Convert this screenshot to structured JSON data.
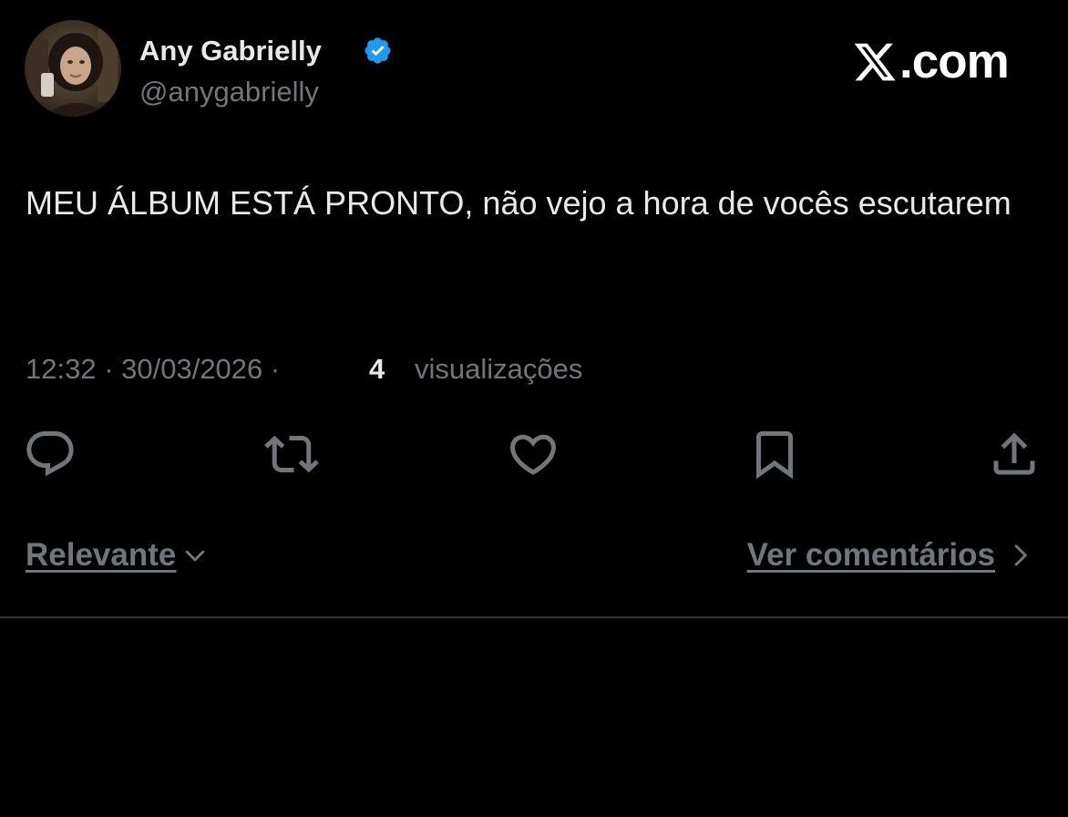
{
  "colors": {
    "background": "#000000",
    "primary_text": "#e7e9ea",
    "secondary_text": "#71767b",
    "verified_blue": "#1d9bf0",
    "divider": "#2f3336"
  },
  "author": {
    "display_name": "Any Gabrielly",
    "handle": "@anygabrielly",
    "verified_icon": "verified-badge-icon"
  },
  "brand": {
    "text": ".com",
    "icon": "x-logo-icon"
  },
  "tweet": {
    "text": "MEU ÁLBUM ESTÁ PRONTO, não vejo a hora de vocês escutarem"
  },
  "meta": {
    "time_date": "12:32 · 30/03/2026 ·",
    "views_count": "4",
    "views_label": "visualizações"
  },
  "actions": [
    {
      "name": "reply",
      "icon": "reply-icon"
    },
    {
      "name": "repost",
      "icon": "repost-icon"
    },
    {
      "name": "like",
      "icon": "heart-icon"
    },
    {
      "name": "bookmark",
      "icon": "bookmark-icon"
    },
    {
      "name": "share",
      "icon": "share-icon"
    }
  ],
  "links": {
    "sort_label": "Relevante",
    "comments_label": "Ver comentários"
  }
}
